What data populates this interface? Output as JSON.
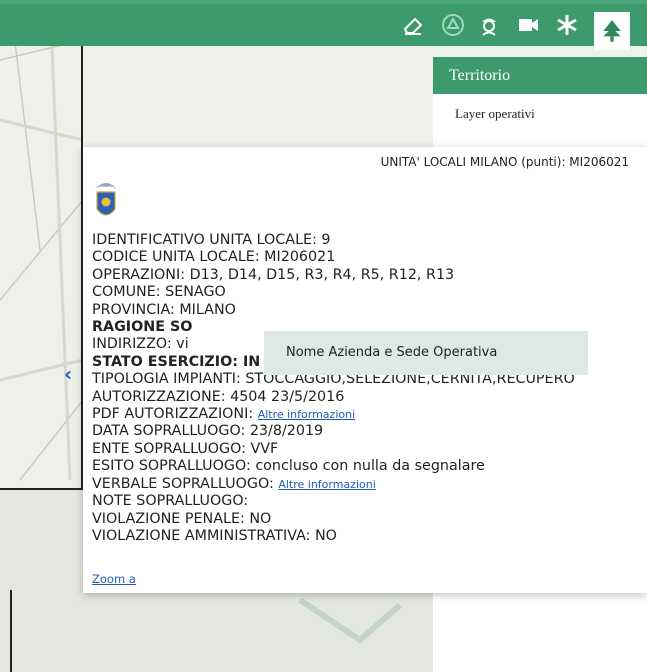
{
  "toolbar": {
    "buttons": [
      {
        "name": "eraser-icon",
        "glyph": "⌫"
      },
      {
        "name": "recycle-icon",
        "glyph": "♲"
      },
      {
        "name": "person-icon",
        "glyph": "☺"
      },
      {
        "name": "video-camera-icon",
        "glyph": "■"
      },
      {
        "name": "snowflake-icon",
        "glyph": "✻"
      },
      {
        "name": "tree-icon",
        "glyph": "♣"
      }
    ]
  },
  "panel": {
    "title": "Territorio",
    "subtitle": "Layer operativi"
  },
  "popup": {
    "title": "UNITA' LOCALI MILANO (punti): MI206021",
    "lines": [
      {
        "text": "IDENTIFICATIVO UNITA LOCALE: 9",
        "bold": false
      },
      {
        "text": "CODICE UNITA LOCALE: MI206021",
        "bold": false
      },
      {
        "text": "OPERAZIONI: D13, D14, D15, R3, R4, R5, R12, R13",
        "bold": false
      },
      {
        "text": "COMUNE: SENAGO",
        "bold": false
      },
      {
        "text": "PROVINCIA: MILANO",
        "bold": false
      },
      {
        "text": "RAGIONE SO",
        "bold": true
      },
      {
        "text": "INDIRIZZO: vi",
        "bold": false
      },
      {
        "text": "STATO ESERCIZIO: IN ESERCIZIO",
        "bold": true
      },
      {
        "text": "TIPOLOGIA IMPIANTI: STOCCAGGIO,SELEZIONE,CERNITA,RECUPERO",
        "bold": false
      },
      {
        "text": "AUTORIZZAZIONE: 4504 23/5/2016",
        "bold": false
      },
      {
        "text": "PDF AUTORIZZAZIONI: ",
        "bold": false,
        "link": "Altre informazioni"
      },
      {
        "text": "DATA SOPRALLUOGO: 23/8/2019",
        "bold": false
      },
      {
        "text": "ENTE SOPRALLUOGO: VVF",
        "bold": false
      },
      {
        "text": "ESITO SOPRALLUOGO: concluso con nulla da segnalare",
        "bold": false
      },
      {
        "text": "VERBALE SOPRALLUOGO: ",
        "bold": false,
        "link": "Altre informazioni"
      },
      {
        "text": "NOTE SOPRALLUOGO:",
        "bold": false
      },
      {
        "text": "VIOLAZIONE PENALE: NO",
        "bold": false
      },
      {
        "text": "VIOLAZIONE AMMINISTRATIVA: NO",
        "bold": false
      }
    ],
    "zoom_label": "Zoom a"
  },
  "tooltip": {
    "text": "Nome Azienda e Sede Operativa"
  },
  "colors": {
    "accent": "#3d9a6b",
    "link": "#1f5bb5",
    "tooltip_bg": "#dde9e4"
  }
}
